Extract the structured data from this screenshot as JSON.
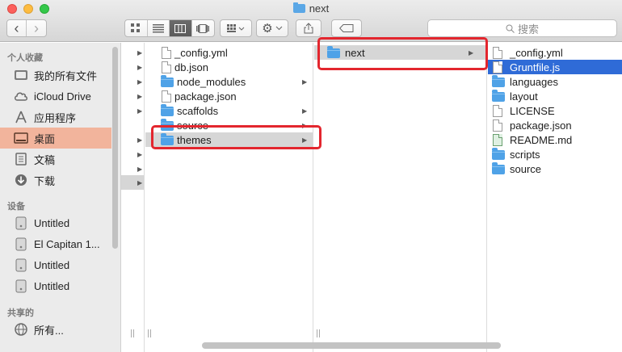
{
  "window": {
    "title": "next",
    "search_placeholder": "搜索",
    "icons": {
      "back": "‹",
      "forward": "›",
      "search": "⌕",
      "gear": "⚙",
      "share": "⇪",
      "tag": "⌧"
    }
  },
  "sidebar": {
    "favorites_heading": "个人收藏",
    "favorites": [
      {
        "label": "我的所有文件",
        "icon": "all-files-icon"
      },
      {
        "label": "iCloud Drive",
        "icon": "cloud-icon"
      },
      {
        "label": "应用程序",
        "icon": "applications-icon"
      },
      {
        "label": "桌面",
        "icon": "desktop-icon",
        "selected": true
      },
      {
        "label": "文稿",
        "icon": "documents-icon"
      },
      {
        "label": "下载",
        "icon": "download-icon"
      }
    ],
    "devices_heading": "设备",
    "devices": [
      {
        "label": "Untitled"
      },
      {
        "label": "El Capitan 1..."
      },
      {
        "label": "Untitled"
      },
      {
        "label": "Untitled"
      }
    ],
    "shared_heading": "共享的",
    "shared": [
      {
        "label": "所有..."
      }
    ]
  },
  "columns": {
    "col2": [
      {
        "name": "_config.yml",
        "type": "file"
      },
      {
        "name": "db.json",
        "type": "file"
      },
      {
        "name": "node_modules",
        "type": "folder",
        "arrow": true
      },
      {
        "name": "package.json",
        "type": "file"
      },
      {
        "name": "scaffolds",
        "type": "folder",
        "arrow": true
      },
      {
        "name": "source",
        "type": "folder",
        "arrow": true
      },
      {
        "name": "themes",
        "type": "folder",
        "arrow": true,
        "selected": true
      }
    ],
    "col3": [
      {
        "name": "next",
        "type": "folder",
        "arrow": true,
        "selected": true
      }
    ],
    "col4": [
      {
        "name": "_config.yml",
        "type": "file"
      },
      {
        "name": "Gruntfile.js",
        "type": "file",
        "selected": true
      },
      {
        "name": "languages",
        "type": "folder"
      },
      {
        "name": "layout",
        "type": "folder"
      },
      {
        "name": "LICENSE",
        "type": "file"
      },
      {
        "name": "package.json",
        "type": "file"
      },
      {
        "name": "README.md",
        "type": "md"
      },
      {
        "name": "scripts",
        "type": "folder"
      },
      {
        "name": "source",
        "type": "folder"
      }
    ]
  },
  "colors": {
    "selection_blue": "#2f6bd7",
    "sidebar_selection": "#f2b49c",
    "highlight_red": "#e3262e"
  }
}
